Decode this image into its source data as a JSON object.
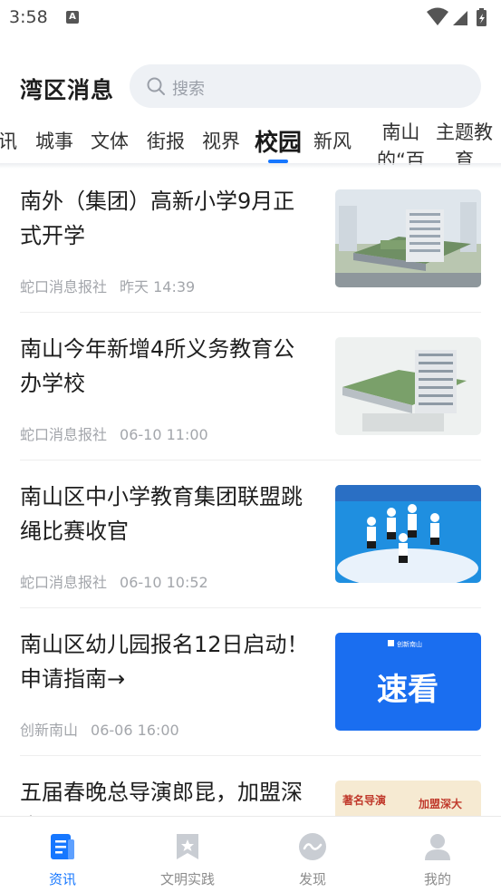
{
  "status_bar": {
    "time": "3:58",
    "notification_glyph": "A"
  },
  "header": {
    "title": "湾区消息",
    "search": {
      "placeholder": "搜索",
      "icon": "search-icon"
    }
  },
  "tabs": [
    {
      "label": "讯"
    },
    {
      "label": "城事"
    },
    {
      "label": "文体"
    },
    {
      "label": "街报"
    },
    {
      "label": "视界"
    },
    {
      "label": "校园",
      "active": true
    },
    {
      "label": "新风"
    },
    {
      "label": "南山\n的“百"
    },
    {
      "label": "主题教\n育"
    }
  ],
  "accent_color": "#1677ff",
  "feed": [
    {
      "title": "南外（集团）高新小学9月正式开学",
      "source": "蛇口消息报社",
      "time": "昨天 14:39",
      "thumb": "school-building"
    },
    {
      "title": "南山今年新增4所义务教育公办学校",
      "source": "蛇口消息报社",
      "time": "06-10 11:00",
      "thumb": "school-building"
    },
    {
      "title": "南山区中小学教育集团联盟跳绳比赛收官",
      "source": "蛇口消息报社",
      "time": "06-10 10:52",
      "thumb": "jump-rope-kids"
    },
    {
      "title": "南山区幼儿园报名12日启动！申请指南→",
      "source": "创新南山",
      "time": "06-06 16:00",
      "thumb": "quick-look-banner",
      "thumb_text": "速看",
      "thumb_brand": "创新南山"
    },
    {
      "title": "五届春晚总导演郎昆，加盟深大",
      "source": "",
      "time": "",
      "thumb": "director-banner",
      "thumb_text_left": "著名导演",
      "thumb_text_right": "加盟深大"
    }
  ],
  "bottom_nav": [
    {
      "label": "资讯",
      "icon": "news-doc-icon",
      "active": true
    },
    {
      "label": "文明实践",
      "icon": "bookmark-star-icon"
    },
    {
      "label": "发现",
      "icon": "discover-wave-icon"
    },
    {
      "label": "我的",
      "icon": "profile-user-icon"
    }
  ]
}
